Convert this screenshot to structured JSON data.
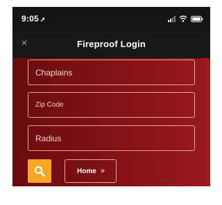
{
  "status_bar": {
    "time": "9:05",
    "location_icon": "location-arrow-icon",
    "signal_icon": "signal-icon",
    "wifi_icon": "wifi-icon",
    "battery_icon": "battery-icon"
  },
  "nav": {
    "close_icon": "close-icon",
    "close_glyph": "×",
    "title": "Fireproof Login"
  },
  "form": {
    "chaplains_value": "Chaplains",
    "zip_placeholder": "Zip Code",
    "radius_placeholder": "Radius"
  },
  "actions": {
    "search_icon": "search-icon",
    "home_label": "Home",
    "home_icon": "double-chevron-right-icon",
    "home_glyph": "»"
  },
  "colors": {
    "status_bar_bg": "#141414",
    "nav_bg": "#181818",
    "content_bg": "#7f1114",
    "field_border": "#e8a3a3",
    "search_button": "#f5a623"
  }
}
